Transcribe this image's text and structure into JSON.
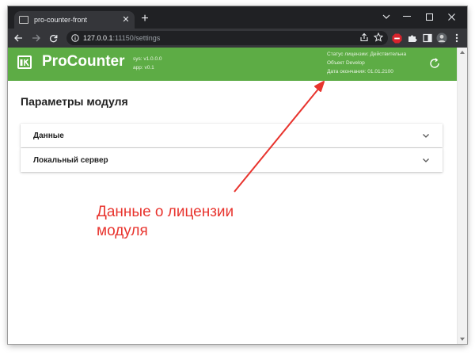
{
  "browser": {
    "tab_title": "pro-counter-front",
    "url_host": "127.0.0.1",
    "url_path": ":11150/settings"
  },
  "app": {
    "brand": "ProCounter",
    "sys_version": "sys: v1.0.0.0",
    "app_version": "app: v0.1",
    "license_status": "Статус лицензии: Действительна",
    "license_object": "Объект Develop",
    "license_expiry": "Дата окончания: 01.01.2100",
    "header_color": "#5dac45"
  },
  "main": {
    "title": "Параметры модуля",
    "panels": [
      {
        "label": "Данные"
      },
      {
        "label": "Локальный сервер"
      }
    ]
  },
  "annotation": {
    "line1": "Данные о лицензии",
    "line2": "модуля",
    "color": "#e8342e"
  }
}
